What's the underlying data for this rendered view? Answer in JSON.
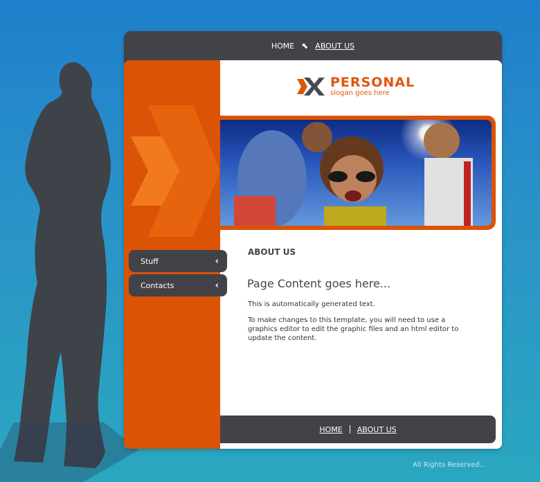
{
  "top_nav": {
    "home": "HOME",
    "about": "ABOUT US"
  },
  "logo": {
    "title": "PERSONAL",
    "slogan": "slogan goes here",
    "accent": "#e0550b"
  },
  "sidebar": {
    "items": [
      {
        "label": "Stuff",
        "icon": "chevron-left-icon"
      },
      {
        "label": "Contacts",
        "icon": "chevron-left-icon"
      }
    ]
  },
  "content": {
    "section_title": "ABOUT US",
    "heading": "Page Content goes here...",
    "paragraphs": [
      "This is automatically generated text.",
      "To make changes to this template, you will need to use a graphics editor to edit the graphic files and an html editor to update the content."
    ]
  },
  "footer": {
    "home": "HOME",
    "about": "ABOUT US"
  },
  "copyright": "All Rights Reserved...",
  "colors": {
    "orange": "#da5306",
    "dark": "#424249",
    "background": "#2a93c8"
  }
}
